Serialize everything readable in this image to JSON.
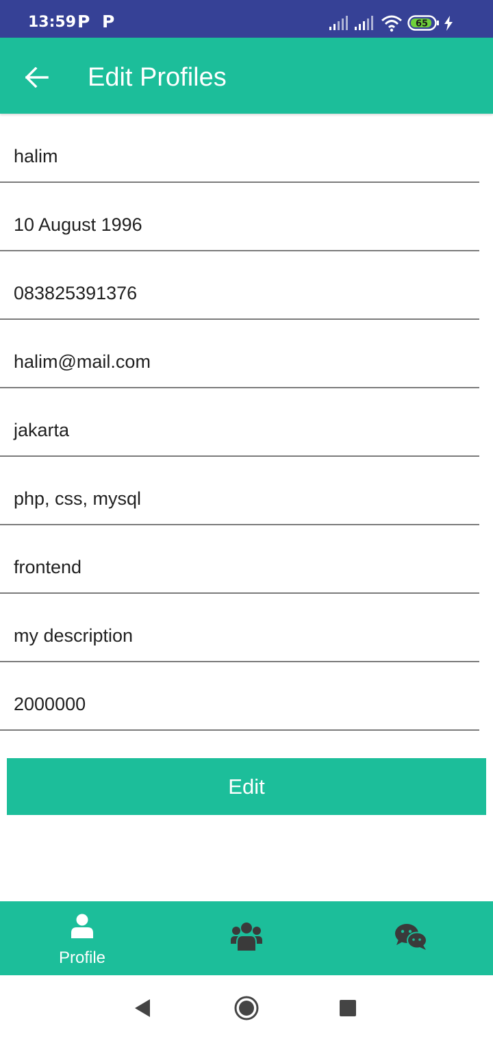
{
  "status_bar": {
    "time": "13:59",
    "notification_icons": [
      "P",
      "P"
    ],
    "battery": "65",
    "icons": [
      "signal-icon",
      "signal-icon",
      "wifi-icon",
      "battery-icon",
      "charging-icon"
    ]
  },
  "app_bar": {
    "title": "Edit Profiles",
    "back_icon": "arrow-left-icon"
  },
  "fields": [
    {
      "name": "name-field",
      "value": "halim"
    },
    {
      "name": "birthdate-field",
      "value": "10 August 1996"
    },
    {
      "name": "phone-field",
      "value": "083825391376"
    },
    {
      "name": "email-field",
      "value": "halim@mail.com"
    },
    {
      "name": "city-field",
      "value": "jakarta"
    },
    {
      "name": "skills-field",
      "value": "php, css, mysql"
    },
    {
      "name": "role-field",
      "value": "frontend"
    },
    {
      "name": "description-field",
      "value": "my description"
    },
    {
      "name": "salary-field",
      "value": "2000000"
    }
  ],
  "edit_button": {
    "label": "Edit"
  },
  "bottom_nav": {
    "items": [
      {
        "label": "Profile",
        "icon": "user-icon",
        "active": true
      },
      {
        "label": "",
        "icon": "users-icon",
        "active": false
      },
      {
        "label": "",
        "icon": "chat-icon",
        "active": false
      }
    ]
  },
  "colors": {
    "status_bar": "#364196",
    "accent": "#1cbe9a",
    "inactive_icon": "#3a3a3a"
  }
}
